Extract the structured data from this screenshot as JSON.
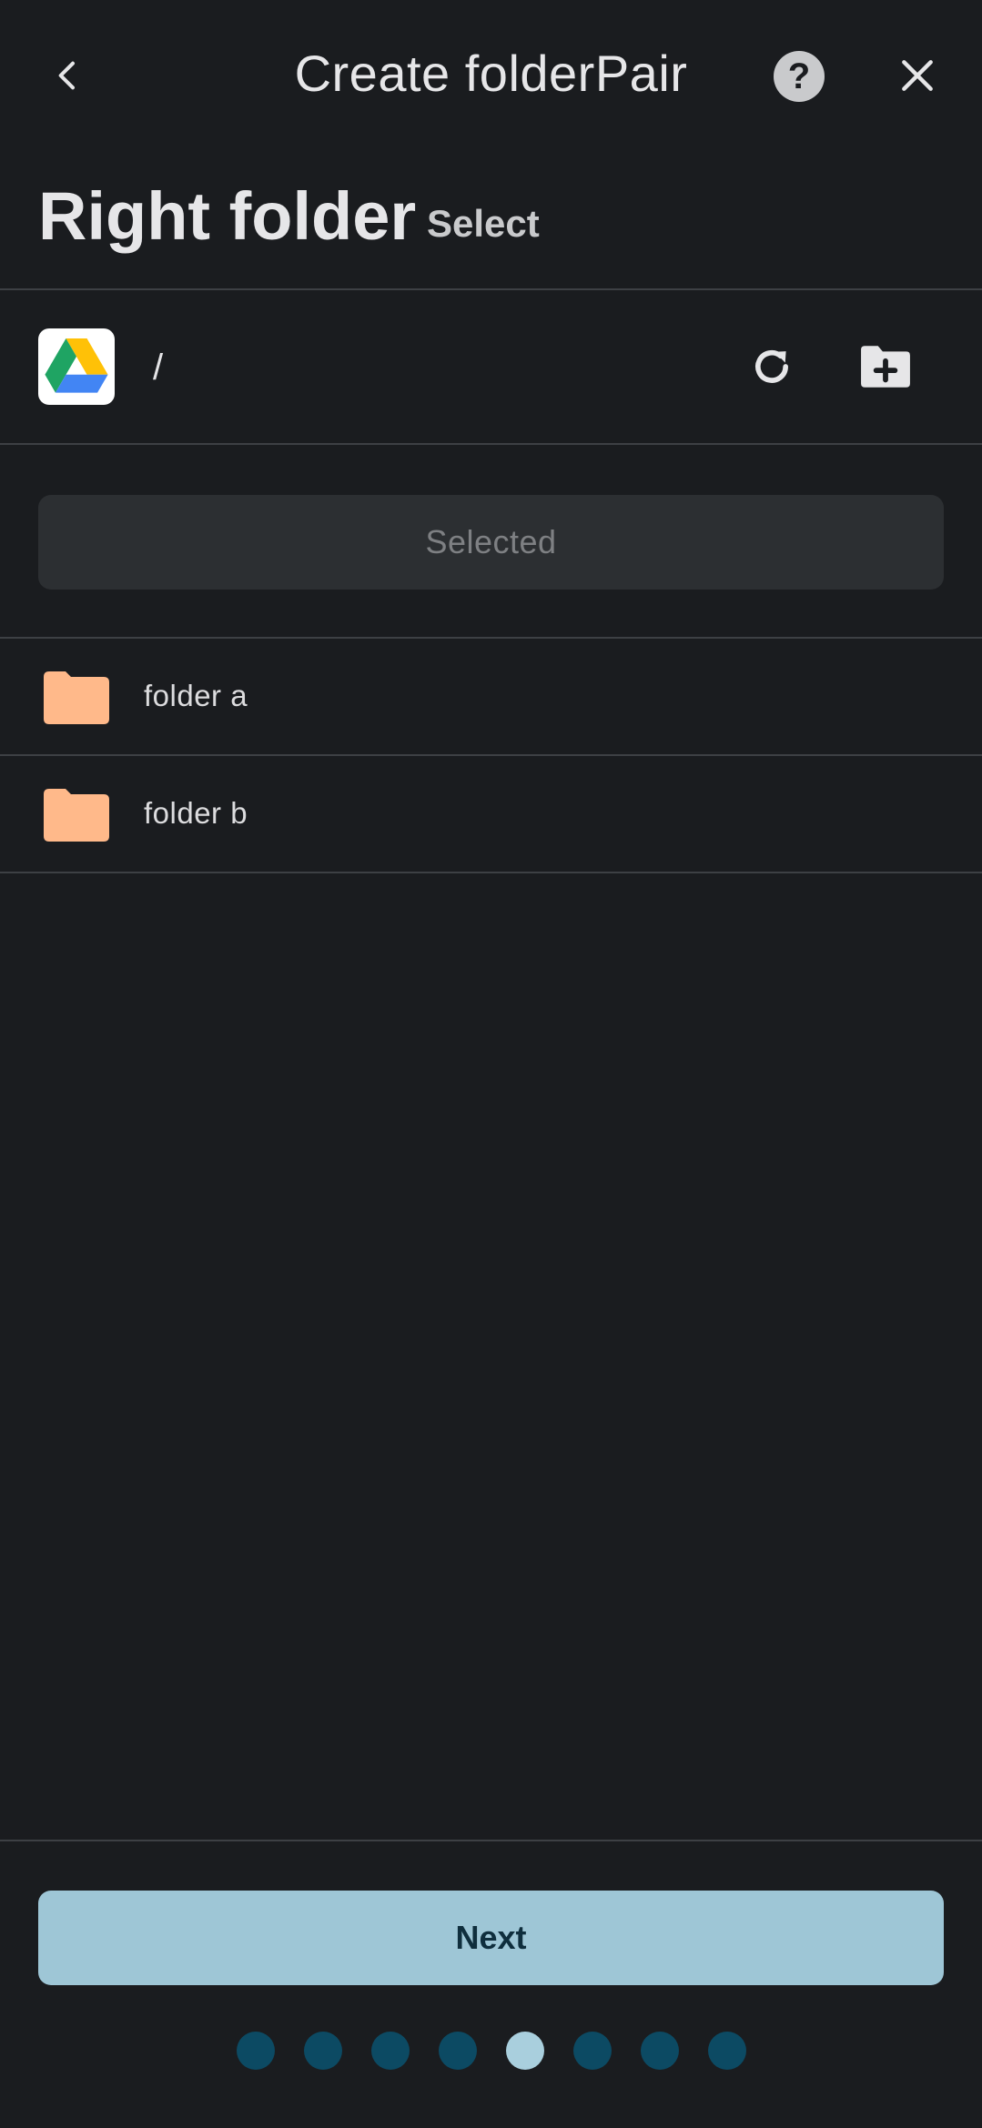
{
  "header": {
    "title": "Create folderPair",
    "back_icon": "chevron-left-icon",
    "help_icon": "help-circle-icon",
    "help_glyph": "?",
    "close_icon": "close-icon"
  },
  "section": {
    "heading": "Right folder",
    "subheading": "Select"
  },
  "path_bar": {
    "provider_icon": "google-drive-icon",
    "path": "/",
    "refresh_icon": "refresh-icon",
    "new_folder_icon": "create-folder-icon"
  },
  "selected_button": {
    "label": "Selected"
  },
  "folders": [
    {
      "label": "folder a",
      "icon": "folder-icon"
    },
    {
      "label": "folder b",
      "icon": "folder-icon"
    }
  ],
  "footer": {
    "next_label": "Next",
    "steps_total": 8,
    "current_step": 5
  },
  "colors": {
    "background": "#1a1c1f",
    "folder": "#ffb98a",
    "next_button": "#9ec6d6",
    "dot_inactive": "#0c4a63",
    "dot_active": "#a9cfdd"
  }
}
